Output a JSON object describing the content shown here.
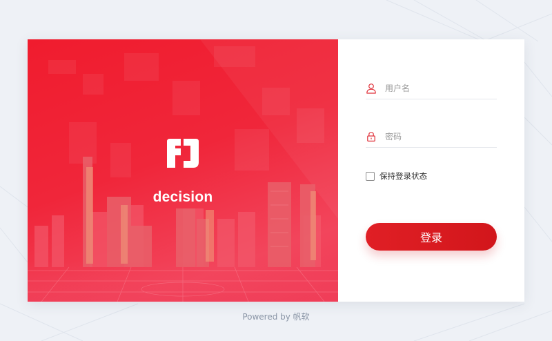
{
  "brand": {
    "name": "decision"
  },
  "login": {
    "username_placeholder": "用户名",
    "password_placeholder": "密码",
    "remember_label": "保持登录状态",
    "submit_label": "登录",
    "remember_checked": false
  },
  "footer": {
    "powered_by": "Powered by 帆软"
  },
  "colors": {
    "accent": "#d81a20",
    "hero_red": "#f01c2e",
    "page_bg": "#eef1f6",
    "icon_red": "#e0313a"
  },
  "icons": {
    "username": "user-icon",
    "password": "lock-icon",
    "logo": "fanruan-logo"
  }
}
